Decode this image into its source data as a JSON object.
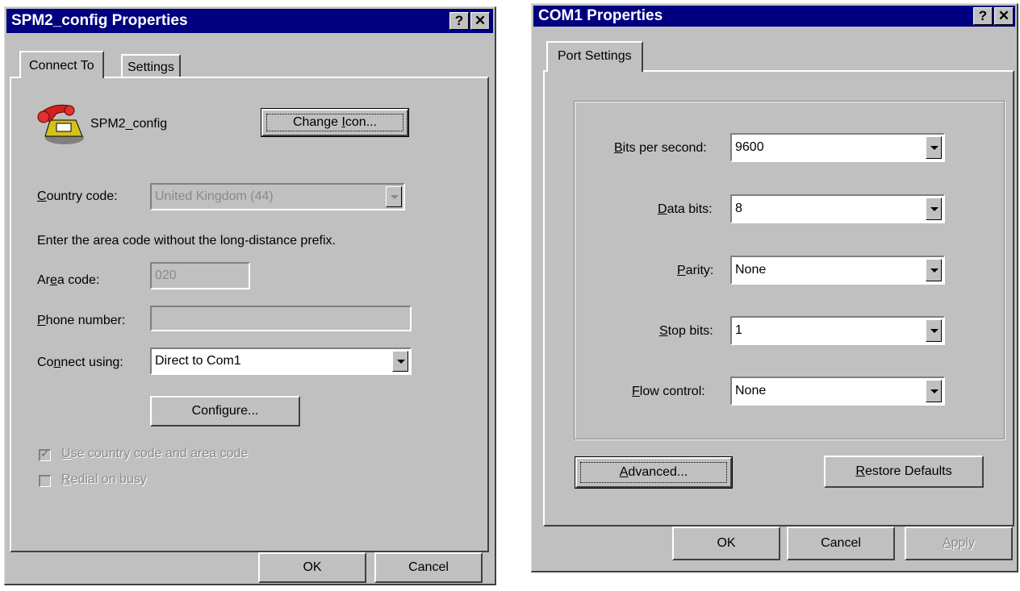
{
  "dialog1": {
    "title": "SPM2_config Properties",
    "help_button": "?",
    "close_button": "✕",
    "tabs": [
      {
        "label": "Connect To"
      },
      {
        "label": "Settings"
      }
    ],
    "connection_name": "SPM2_config",
    "change_icon_button": {
      "before": "Change ",
      "mnemonic": "I",
      "after": "con..."
    },
    "country_code": {
      "before": "",
      "mnemonic": "C",
      "after": "ountry code:",
      "value": "United Kingdom (44)"
    },
    "area_instruction": "Enter the area code without the long-distance prefix.",
    "area_code": {
      "before": "Ar",
      "mnemonic": "e",
      "after": "a code:",
      "value": "020"
    },
    "phone_number": {
      "before": "",
      "mnemonic": "P",
      "after": "hone number:",
      "value": ""
    },
    "connect_using": {
      "before": "Co",
      "mnemonic": "n",
      "after": "nect using:",
      "value": "Direct to Com1"
    },
    "configure_button": {
      "before": "Confi",
      "mnemonic": "g",
      "after": "ure..."
    },
    "use_country_code": {
      "before": "",
      "mnemonic": "U",
      "after": "se country code and area code",
      "checked": true
    },
    "redial_on_busy": {
      "before": "",
      "mnemonic": "R",
      "after": "edial on busy",
      "checked": false
    },
    "ok_button": "OK",
    "cancel_button": "Cancel"
  },
  "dialog2": {
    "title": "COM1 Properties",
    "help_button": "?",
    "close_button": "✕",
    "tab": "Port Settings",
    "bits_per_second": {
      "before": "",
      "mnemonic": "B",
      "after": "its per second:",
      "value": "9600"
    },
    "data_bits": {
      "before": "",
      "mnemonic": "D",
      "after": "ata bits:",
      "value": "8"
    },
    "parity": {
      "before": "",
      "mnemonic": "P",
      "after": "arity:",
      "value": "None"
    },
    "stop_bits": {
      "before": "",
      "mnemonic": "S",
      "after": "top bits:",
      "value": "1"
    },
    "flow_control": {
      "before": "",
      "mnemonic": "F",
      "after": "low control:",
      "value": "None"
    },
    "advanced_button": {
      "before": "",
      "mnemonic": "A",
      "after": "dvanced..."
    },
    "restore_defaults_button": {
      "before": "",
      "mnemonic": "R",
      "after": "estore Defaults"
    },
    "ok_button": "OK",
    "cancel_button": "Cancel",
    "apply_button": {
      "before": "",
      "mnemonic": "A",
      "after": "pply"
    }
  }
}
